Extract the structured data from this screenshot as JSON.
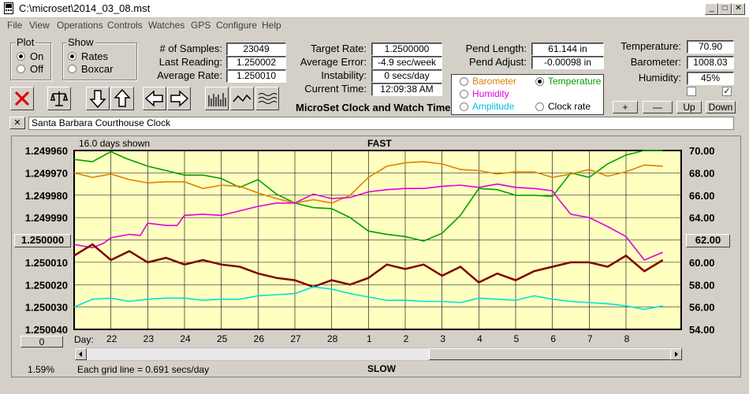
{
  "window": {
    "title": "C:\\microset\\2014_03_08.mst",
    "min": "_",
    "max": "□",
    "close": "✕"
  },
  "menu": [
    "File",
    "View",
    "Operations",
    "Controls",
    "Watches",
    "GPS",
    "Configure",
    "Help"
  ],
  "plot": {
    "label": "Plot",
    "options": [
      "On",
      "Off"
    ],
    "selected": "On"
  },
  "show": {
    "label": "Show",
    "options": [
      "Rates",
      "Boxcar"
    ],
    "selected": "Rates"
  },
  "stats": {
    "samples_label": "# of Samples:",
    "samples": "23049",
    "last_label": "Last Reading:",
    "last": "1.250002",
    "avg_label": "Average Rate:",
    "avg": "1.250010"
  },
  "rates": {
    "target_label": "Target Rate:",
    "target": "1.2500000",
    "avgerr_label": "Average Error:",
    "avgerr": "-4.9 sec/week",
    "instab_label": "Instability:",
    "instab": "0 secs/day",
    "time_label": "Current Time:",
    "time": "12:09:38 AM"
  },
  "app_caption": "MicroSet Clock and Watch Timer",
  "pend": {
    "length_label": "Pend Length:",
    "length": "61.144 in",
    "adjust_label": "Pend Adjust:",
    "adjust": "-0.00098 in"
  },
  "env": {
    "temp_label": "Temperature:",
    "temp": "70.90",
    "baro_label": "Barometer:",
    "baro": "1008.03",
    "hum_label": "Humidity:",
    "hum": "45%"
  },
  "sensor_options": {
    "barometer": "Barometer",
    "temperature": "Temperature",
    "humidity": "Humidity",
    "amplitude": "Amplitude",
    "clock_rate": "Clock rate",
    "selected": "Temperature"
  },
  "scale_buttons": {
    "plus": "+",
    "minus": "—",
    "up": "Up",
    "down": "Down"
  },
  "clock_name": "Santa Barbara Courthouse Clock",
  "close_x": "✕",
  "colors": {
    "barometer": "#e08000",
    "temperature": "#00a000",
    "humidity": "#e000e0",
    "amplitude": "#00e0e0",
    "rate": "#800000",
    "plot_bg": "#ffffc0"
  },
  "chart_data": {
    "type": "line",
    "title": "FAST",
    "bottom_label": "SLOW",
    "days_shown": "16.0 days shown",
    "grid_note": "Each grid line = 0.691 secs/day",
    "zoom": "1.59%",
    "left_button": "1.250000",
    "right_button": "62.00",
    "bottom_left_button": "0",
    "x_prefix": "Day:",
    "x_ticks": [
      "22",
      "23",
      "24",
      "25",
      "26",
      "27",
      "28",
      "1",
      "2",
      "3",
      "4",
      "5",
      "6",
      "7",
      "8"
    ],
    "y_left_ticks": [
      "1.249960",
      "1.249970",
      "1.249980",
      "1.249990",
      "1.250000",
      "1.250010",
      "1.250020",
      "1.250030",
      "1.250040"
    ],
    "y_right_ticks": [
      "70.00",
      "68.00",
      "66.00",
      "64.00",
      "62.00",
      "60.00",
      "58.00",
      "56.00",
      "54.00"
    ],
    "ylim_left": [
      1.24996,
      1.25004
    ],
    "ylim_right": [
      54,
      70
    ],
    "grid": true,
    "series": [
      {
        "key": "temperature",
        "x": [
          21.0,
          21.5,
          22.0,
          22.4,
          23.0,
          23.5,
          24.0,
          24.5,
          25.0,
          25.5,
          26.0,
          26.5,
          27.0,
          27.5,
          28.0,
          28.5,
          29.0,
          29.5,
          30.0,
          30.5,
          31.0,
          31.5,
          32.0,
          32.5,
          33.0,
          33.5,
          34.0,
          34.5,
          35.0,
          35.5,
          36.0,
          36.5,
          37.0
        ],
        "values": [
          69.2,
          69.0,
          69.9,
          69.3,
          68.6,
          68.2,
          67.8,
          67.8,
          67.5,
          66.7,
          67.4,
          66.1,
          65.3,
          64.9,
          64.8,
          64.0,
          62.8,
          62.5,
          62.3,
          61.9,
          62.6,
          64.2,
          66.6,
          66.5,
          66.0,
          66.0,
          65.9,
          68.0,
          67.6,
          68.8,
          69.6,
          70.0,
          70.0
        ]
      },
      {
        "key": "barometer",
        "x": [
          21.0,
          21.5,
          22.0,
          22.5,
          23.0,
          23.5,
          24.0,
          24.5,
          25.0,
          25.5,
          26.0,
          26.5,
          27.0,
          27.5,
          28.0,
          28.5,
          29.0,
          29.5,
          30.0,
          30.5,
          31.0,
          31.5,
          32.0,
          32.5,
          33.0,
          33.5,
          34.0,
          34.5,
          35.0,
          35.5,
          36.0,
          36.5,
          37.0
        ],
        "values": [
          68.0,
          67.6,
          67.9,
          67.4,
          67.1,
          67.2,
          67.2,
          66.6,
          66.9,
          66.8,
          66.2,
          65.7,
          65.3,
          65.6,
          65.3,
          66.0,
          67.6,
          68.6,
          68.9,
          69.0,
          68.8,
          68.3,
          68.2,
          67.9,
          68.1,
          68.1,
          67.6,
          67.9,
          68.3,
          67.7,
          68.1,
          68.7,
          68.6
        ]
      },
      {
        "key": "humidity",
        "x": [
          21.0,
          21.5,
          21.8,
          22.0,
          22.5,
          22.8,
          23.0,
          23.5,
          23.8,
          24.0,
          24.5,
          25.0,
          25.5,
          26.0,
          26.5,
          27.0,
          27.5,
          28.0,
          28.5,
          29.0,
          29.5,
          30.0,
          30.5,
          31.0,
          31.5,
          32.0,
          32.5,
          33.0,
          33.5,
          34.0,
          34.2,
          34.5,
          35.0,
          35.5,
          36.0,
          36.5,
          37.0
        ],
        "values": [
          61.6,
          61.3,
          61.7,
          62.2,
          62.5,
          62.4,
          63.5,
          63.3,
          63.3,
          64.2,
          64.3,
          64.2,
          64.6,
          65.0,
          65.3,
          65.3,
          66.1,
          65.7,
          65.8,
          66.3,
          66.5,
          66.6,
          66.6,
          66.8,
          66.9,
          66.7,
          67.0,
          66.7,
          66.6,
          66.4,
          65.5,
          64.3,
          64.0,
          63.2,
          62.3,
          60.2,
          60.9
        ]
      },
      {
        "key": "rate",
        "x": [
          21.0,
          21.5,
          22.0,
          22.5,
          23.0,
          23.5,
          24.0,
          24.5,
          25.0,
          25.5,
          26.0,
          26.5,
          27.0,
          27.5,
          28.0,
          28.5,
          29.0,
          29.5,
          30.0,
          30.5,
          31.0,
          31.5,
          32.0,
          32.5,
          33.0,
          33.5,
          34.0,
          34.5,
          35.0,
          35.5,
          36.0,
          36.5,
          37.0
        ],
        "values": [
          1.250007,
          1.250002,
          1.250009,
          1.250005,
          1.25001,
          1.250008,
          1.250011,
          1.250009,
          1.250011,
          1.250012,
          1.250015,
          1.250017,
          1.250018,
          1.250021,
          1.250018,
          1.25002,
          1.250017,
          1.250011,
          1.250013,
          1.250011,
          1.250016,
          1.250012,
          1.250019,
          1.250015,
          1.250018,
          1.250014,
          1.250012,
          1.25001,
          1.25001,
          1.250012,
          1.250007,
          1.250014,
          1.250009
        ]
      },
      {
        "key": "amplitude",
        "x": [
          21.0,
          21.5,
          22.0,
          22.5,
          23.0,
          23.5,
          24.0,
          24.5,
          25.0,
          25.5,
          26.0,
          26.5,
          27.0,
          27.5,
          28.0,
          28.5,
          29.0,
          29.5,
          30.0,
          30.5,
          31.0,
          31.5,
          32.0,
          32.5,
          33.0,
          33.5,
          34.0,
          34.5,
          35.0,
          35.5,
          36.0,
          36.5,
          37.0
        ],
        "values": [
          56.0,
          56.7,
          56.8,
          56.5,
          56.7,
          56.8,
          56.8,
          56.6,
          56.7,
          56.7,
          57.0,
          57.1,
          57.2,
          57.8,
          57.6,
          57.2,
          56.9,
          56.6,
          56.6,
          56.5,
          56.5,
          56.4,
          56.8,
          56.7,
          56.6,
          57.0,
          56.7,
          56.5,
          56.4,
          56.3,
          56.1,
          55.8,
          56.1
        ]
      }
    ]
  }
}
